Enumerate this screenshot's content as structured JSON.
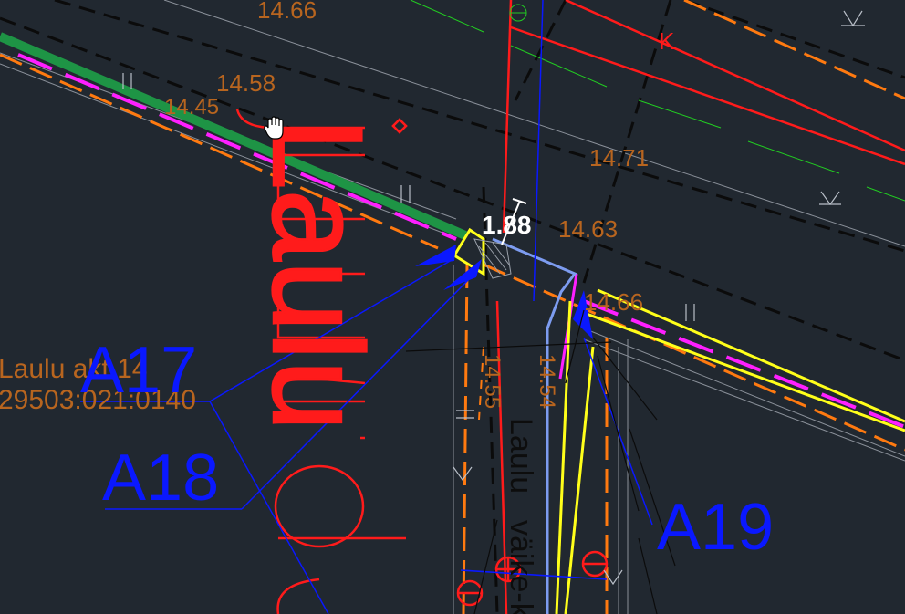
{
  "canvas": {
    "background": "#212830",
    "cursor_icon": "hand-pan-icon"
  },
  "labels": {
    "elev_top": "14.66",
    "elev_1": "14.58",
    "elev_2": "14.45",
    "elev_3": "14.71",
    "elev_4": "14.63",
    "elev_5": "14.66",
    "elev_6": "14.55",
    "elev_7": "14.54",
    "dimension": "1.88",
    "parcel_name": "Laulu akt 14",
    "parcel_id": "29503:021:0140",
    "callout_a17": "A17",
    "callout_a18": "A18",
    "callout_a19": "A19",
    "street_vertical": "Laulu",
    "street_vertical_2": "väike-kl",
    "red_letter": "K",
    "street_big": "Laulu"
  },
  "colors": {
    "green_band": "#1e9445",
    "magenta": "#ff1fff",
    "orange": "#ff7a10",
    "yellow": "#ffff1a",
    "red": "#ff1b1b",
    "blue": "#0a18ff",
    "light_blue": "#7d9cf0",
    "black_dash": "#0b0b0b",
    "white": "#ffffff"
  }
}
